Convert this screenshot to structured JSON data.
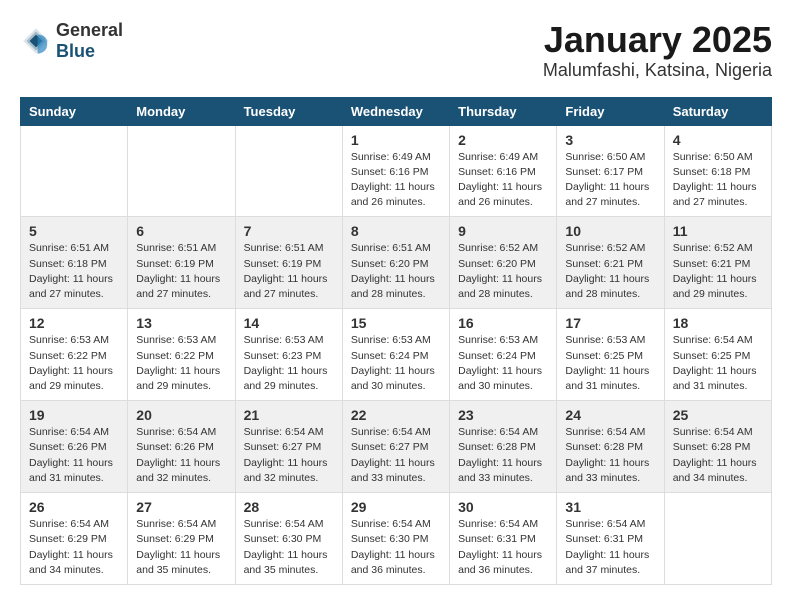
{
  "header": {
    "logo_general": "General",
    "logo_blue": "Blue",
    "month": "January 2025",
    "location": "Malumfashi, Katsina, Nigeria"
  },
  "weekdays": [
    "Sunday",
    "Monday",
    "Tuesday",
    "Wednesday",
    "Thursday",
    "Friday",
    "Saturday"
  ],
  "weeks": [
    [
      {
        "day": "",
        "info": ""
      },
      {
        "day": "",
        "info": ""
      },
      {
        "day": "",
        "info": ""
      },
      {
        "day": "1",
        "info": "Sunrise: 6:49 AM\nSunset: 6:16 PM\nDaylight: 11 hours\nand 26 minutes."
      },
      {
        "day": "2",
        "info": "Sunrise: 6:49 AM\nSunset: 6:16 PM\nDaylight: 11 hours\nand 26 minutes."
      },
      {
        "day": "3",
        "info": "Sunrise: 6:50 AM\nSunset: 6:17 PM\nDaylight: 11 hours\nand 27 minutes."
      },
      {
        "day": "4",
        "info": "Sunrise: 6:50 AM\nSunset: 6:18 PM\nDaylight: 11 hours\nand 27 minutes."
      }
    ],
    [
      {
        "day": "5",
        "info": "Sunrise: 6:51 AM\nSunset: 6:18 PM\nDaylight: 11 hours\nand 27 minutes."
      },
      {
        "day": "6",
        "info": "Sunrise: 6:51 AM\nSunset: 6:19 PM\nDaylight: 11 hours\nand 27 minutes."
      },
      {
        "day": "7",
        "info": "Sunrise: 6:51 AM\nSunset: 6:19 PM\nDaylight: 11 hours\nand 27 minutes."
      },
      {
        "day": "8",
        "info": "Sunrise: 6:51 AM\nSunset: 6:20 PM\nDaylight: 11 hours\nand 28 minutes."
      },
      {
        "day": "9",
        "info": "Sunrise: 6:52 AM\nSunset: 6:20 PM\nDaylight: 11 hours\nand 28 minutes."
      },
      {
        "day": "10",
        "info": "Sunrise: 6:52 AM\nSunset: 6:21 PM\nDaylight: 11 hours\nand 28 minutes."
      },
      {
        "day": "11",
        "info": "Sunrise: 6:52 AM\nSunset: 6:21 PM\nDaylight: 11 hours\nand 29 minutes."
      }
    ],
    [
      {
        "day": "12",
        "info": "Sunrise: 6:53 AM\nSunset: 6:22 PM\nDaylight: 11 hours\nand 29 minutes."
      },
      {
        "day": "13",
        "info": "Sunrise: 6:53 AM\nSunset: 6:22 PM\nDaylight: 11 hours\nand 29 minutes."
      },
      {
        "day": "14",
        "info": "Sunrise: 6:53 AM\nSunset: 6:23 PM\nDaylight: 11 hours\nand 29 minutes."
      },
      {
        "day": "15",
        "info": "Sunrise: 6:53 AM\nSunset: 6:24 PM\nDaylight: 11 hours\nand 30 minutes."
      },
      {
        "day": "16",
        "info": "Sunrise: 6:53 AM\nSunset: 6:24 PM\nDaylight: 11 hours\nand 30 minutes."
      },
      {
        "day": "17",
        "info": "Sunrise: 6:53 AM\nSunset: 6:25 PM\nDaylight: 11 hours\nand 31 minutes."
      },
      {
        "day": "18",
        "info": "Sunrise: 6:54 AM\nSunset: 6:25 PM\nDaylight: 11 hours\nand 31 minutes."
      }
    ],
    [
      {
        "day": "19",
        "info": "Sunrise: 6:54 AM\nSunset: 6:26 PM\nDaylight: 11 hours\nand 31 minutes."
      },
      {
        "day": "20",
        "info": "Sunrise: 6:54 AM\nSunset: 6:26 PM\nDaylight: 11 hours\nand 32 minutes."
      },
      {
        "day": "21",
        "info": "Sunrise: 6:54 AM\nSunset: 6:27 PM\nDaylight: 11 hours\nand 32 minutes."
      },
      {
        "day": "22",
        "info": "Sunrise: 6:54 AM\nSunset: 6:27 PM\nDaylight: 11 hours\nand 33 minutes."
      },
      {
        "day": "23",
        "info": "Sunrise: 6:54 AM\nSunset: 6:28 PM\nDaylight: 11 hours\nand 33 minutes."
      },
      {
        "day": "24",
        "info": "Sunrise: 6:54 AM\nSunset: 6:28 PM\nDaylight: 11 hours\nand 33 minutes."
      },
      {
        "day": "25",
        "info": "Sunrise: 6:54 AM\nSunset: 6:28 PM\nDaylight: 11 hours\nand 34 minutes."
      }
    ],
    [
      {
        "day": "26",
        "info": "Sunrise: 6:54 AM\nSunset: 6:29 PM\nDaylight: 11 hours\nand 34 minutes."
      },
      {
        "day": "27",
        "info": "Sunrise: 6:54 AM\nSunset: 6:29 PM\nDaylight: 11 hours\nand 35 minutes."
      },
      {
        "day": "28",
        "info": "Sunrise: 6:54 AM\nSunset: 6:30 PM\nDaylight: 11 hours\nand 35 minutes."
      },
      {
        "day": "29",
        "info": "Sunrise: 6:54 AM\nSunset: 6:30 PM\nDaylight: 11 hours\nand 36 minutes."
      },
      {
        "day": "30",
        "info": "Sunrise: 6:54 AM\nSunset: 6:31 PM\nDaylight: 11 hours\nand 36 minutes."
      },
      {
        "day": "31",
        "info": "Sunrise: 6:54 AM\nSunset: 6:31 PM\nDaylight: 11 hours\nand 37 minutes."
      },
      {
        "day": "",
        "info": ""
      }
    ]
  ]
}
